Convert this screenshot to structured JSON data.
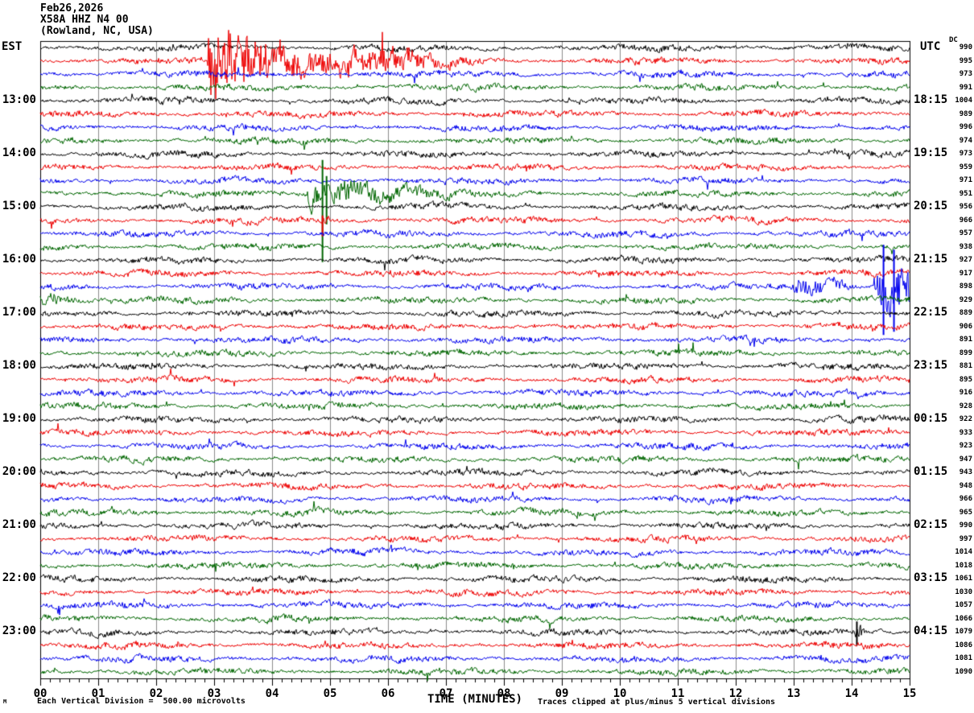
{
  "chart_data": {
    "type": "line",
    "subtype": "helicorder-seismogram",
    "title": {
      "date": "Feb26,2026",
      "station": "X58A HHZ N4 00",
      "location": "(Rowland, NC, USA)"
    },
    "axis": {
      "left_tz": "EST",
      "right_tz": "UTC",
      "dc_header": "DC",
      "x_title": "TIME (MINUTES)",
      "x_ticks": [
        "00",
        "01",
        "02",
        "03",
        "04",
        "05",
        "06",
        "07",
        "08",
        "09",
        "10",
        "11",
        "12",
        "13",
        "14",
        "15"
      ],
      "minutes_per_row": 15,
      "rows_total": 48,
      "grid": "vertical-per-minute"
    },
    "footer": {
      "scale_note": "Each Vertical Division =  500.00 microvolts",
      "clip_note": "Traces clipped at plus/minus 5 vertical divisions",
      "mini_mark": "M"
    },
    "style": {
      "trace_colors": [
        "#000000",
        "#ee0000",
        "#0000ee",
        "#006600"
      ],
      "grid_color": "#8c8c8c",
      "border_color": "#000000",
      "background": "#ffffff"
    },
    "rows": [
      {
        "dc": 990
      },
      {
        "dc": 995
      },
      {
        "dc": 973
      },
      {
        "dc": 991
      },
      {
        "est": "13:00",
        "utc": "18:15",
        "dc": 1004
      },
      {
        "dc": 989
      },
      {
        "dc": 996
      },
      {
        "dc": 974
      },
      {
        "est": "14:00",
        "utc": "19:15",
        "dc": 973
      },
      {
        "dc": 959
      },
      {
        "dc": 971
      },
      {
        "dc": 951
      },
      {
        "est": "15:00",
        "utc": "20:15",
        "dc": 956
      },
      {
        "dc": 966
      },
      {
        "dc": 957
      },
      {
        "dc": 938
      },
      {
        "est": "16:00",
        "utc": "21:15",
        "dc": 927
      },
      {
        "dc": 917
      },
      {
        "dc": 898
      },
      {
        "dc": 929
      },
      {
        "est": "17:00",
        "utc": "22:15",
        "dc": 889
      },
      {
        "dc": 906
      },
      {
        "dc": 891
      },
      {
        "dc": 899
      },
      {
        "est": "18:00",
        "utc": "23:15",
        "dc": 881
      },
      {
        "dc": 895
      },
      {
        "dc": 916
      },
      {
        "dc": 928
      },
      {
        "est": "19:00",
        "utc": "00:15",
        "dc": 922
      },
      {
        "dc": 933
      },
      {
        "dc": 923
      },
      {
        "dc": 947
      },
      {
        "est": "20:00",
        "utc": "01:15",
        "dc": 943
      },
      {
        "dc": 948
      },
      {
        "dc": 966
      },
      {
        "dc": 965
      },
      {
        "est": "21:00",
        "utc": "02:15",
        "dc": 990
      },
      {
        "dc": 997
      },
      {
        "dc": 1014
      },
      {
        "dc": 1018
      },
      {
        "est": "22:00",
        "utc": "03:15",
        "dc": 1061
      },
      {
        "dc": 1030
      },
      {
        "dc": 1057
      },
      {
        "dc": 1066
      },
      {
        "est": "23:00",
        "utc": "04:15",
        "dc": 1079
      },
      {
        "dc": 1086
      },
      {
        "dc": 1081
      },
      {
        "dc": 1090
      }
    ],
    "events": [
      {
        "row": 1,
        "start": 2.85,
        "end": 3.95,
        "amp": 38,
        "coda": 1.6,
        "desc": "large clipped burst on 12:15 EST red trace with long coda"
      },
      {
        "row": 11,
        "start": 4.55,
        "end": 5.35,
        "amp": 22,
        "coda": 0.9,
        "spikes": [
          {
            "t": 4.87,
            "up": 42,
            "down": 85
          },
          {
            "t": 4.94,
            "up": 22,
            "down": 38
          }
        ],
        "desc": "clipped burst on 14:45 EST green trace, spike spans 5 divisions"
      },
      {
        "row": 13,
        "start": 4.8,
        "end": 4.95,
        "amp": 7,
        "coda": 0.1,
        "spikes": [
          {
            "t": 4.87,
            "up": 6,
            "down": 20
          }
        ],
        "desc": "small echo spike on 15:15 EST red trace"
      },
      {
        "row": 18,
        "start": 12.95,
        "end": 13.75,
        "amp": 12,
        "coda": 0.35,
        "desc": "moderate burst on 16:30 EST blue trace"
      },
      {
        "row": 18,
        "start": 14.35,
        "end": 15.02,
        "amp": 32,
        "coda": 0.5,
        "spikes": [
          {
            "t": 14.55,
            "up": 52,
            "down": 60
          },
          {
            "t": 14.73,
            "up": 46,
            "down": 56
          }
        ],
        "desc": "large clipped burst at end of 16:30 EST blue trace"
      },
      {
        "row": 19,
        "start": -0.3,
        "end": 0.25,
        "amp": 13,
        "coda": 0.45,
        "desc": "event coda continuing onto 16:45 EST green trace"
      },
      {
        "row": 44,
        "start": 14.03,
        "end": 14.17,
        "amp": 11,
        "coda": 0.06,
        "spikes": [
          {
            "t": 14.09,
            "up": 13,
            "down": 17
          }
        ],
        "desc": "small spike on 23:00 EST black trace"
      }
    ]
  }
}
